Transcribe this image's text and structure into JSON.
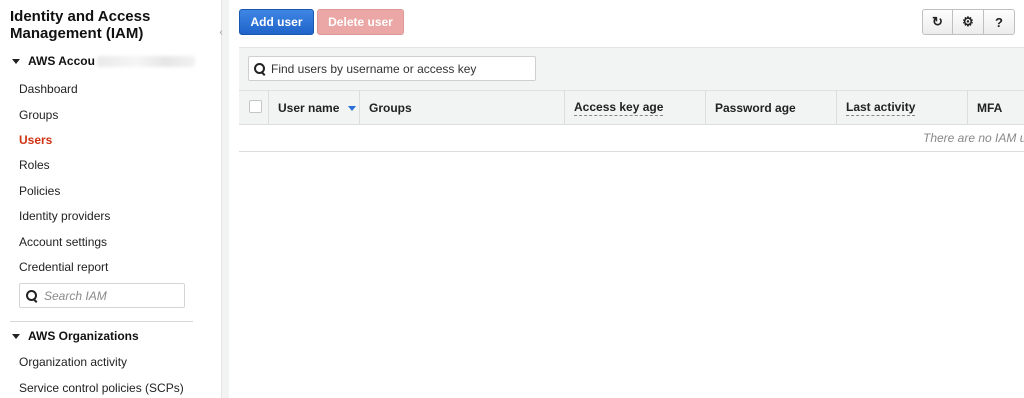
{
  "sidebar": {
    "title": "Identity and Access Management (IAM)",
    "collapse_glyph": "‹",
    "account_label": "AWS Accou",
    "items": [
      {
        "label": "Dashboard"
      },
      {
        "label": "Groups"
      },
      {
        "label": "Users",
        "active": true
      },
      {
        "label": "Roles"
      },
      {
        "label": "Policies"
      },
      {
        "label": "Identity providers"
      },
      {
        "label": "Account settings"
      },
      {
        "label": "Credential report"
      }
    ],
    "search_placeholder": "Search IAM",
    "org_label": "AWS Organizations",
    "org_items": [
      {
        "label": "Organization activity"
      },
      {
        "label": "Service control policies (SCPs)"
      }
    ]
  },
  "toolbar": {
    "add_user_label": "Add user",
    "delete_user_label": "Delete user",
    "refresh_icon": "↻",
    "settings_icon": "⚙",
    "help_icon": "?"
  },
  "table": {
    "search_placeholder": "Find users by username or access key",
    "columns": [
      "User name",
      "Groups",
      "Access key age",
      "Password age",
      "Last activity",
      "MFA"
    ],
    "empty_message": "There are no IAM u"
  },
  "colors": {
    "primary": "#2a6fd6",
    "active_nav": "#d13212",
    "danger_disabled": "#eaa7a5"
  }
}
